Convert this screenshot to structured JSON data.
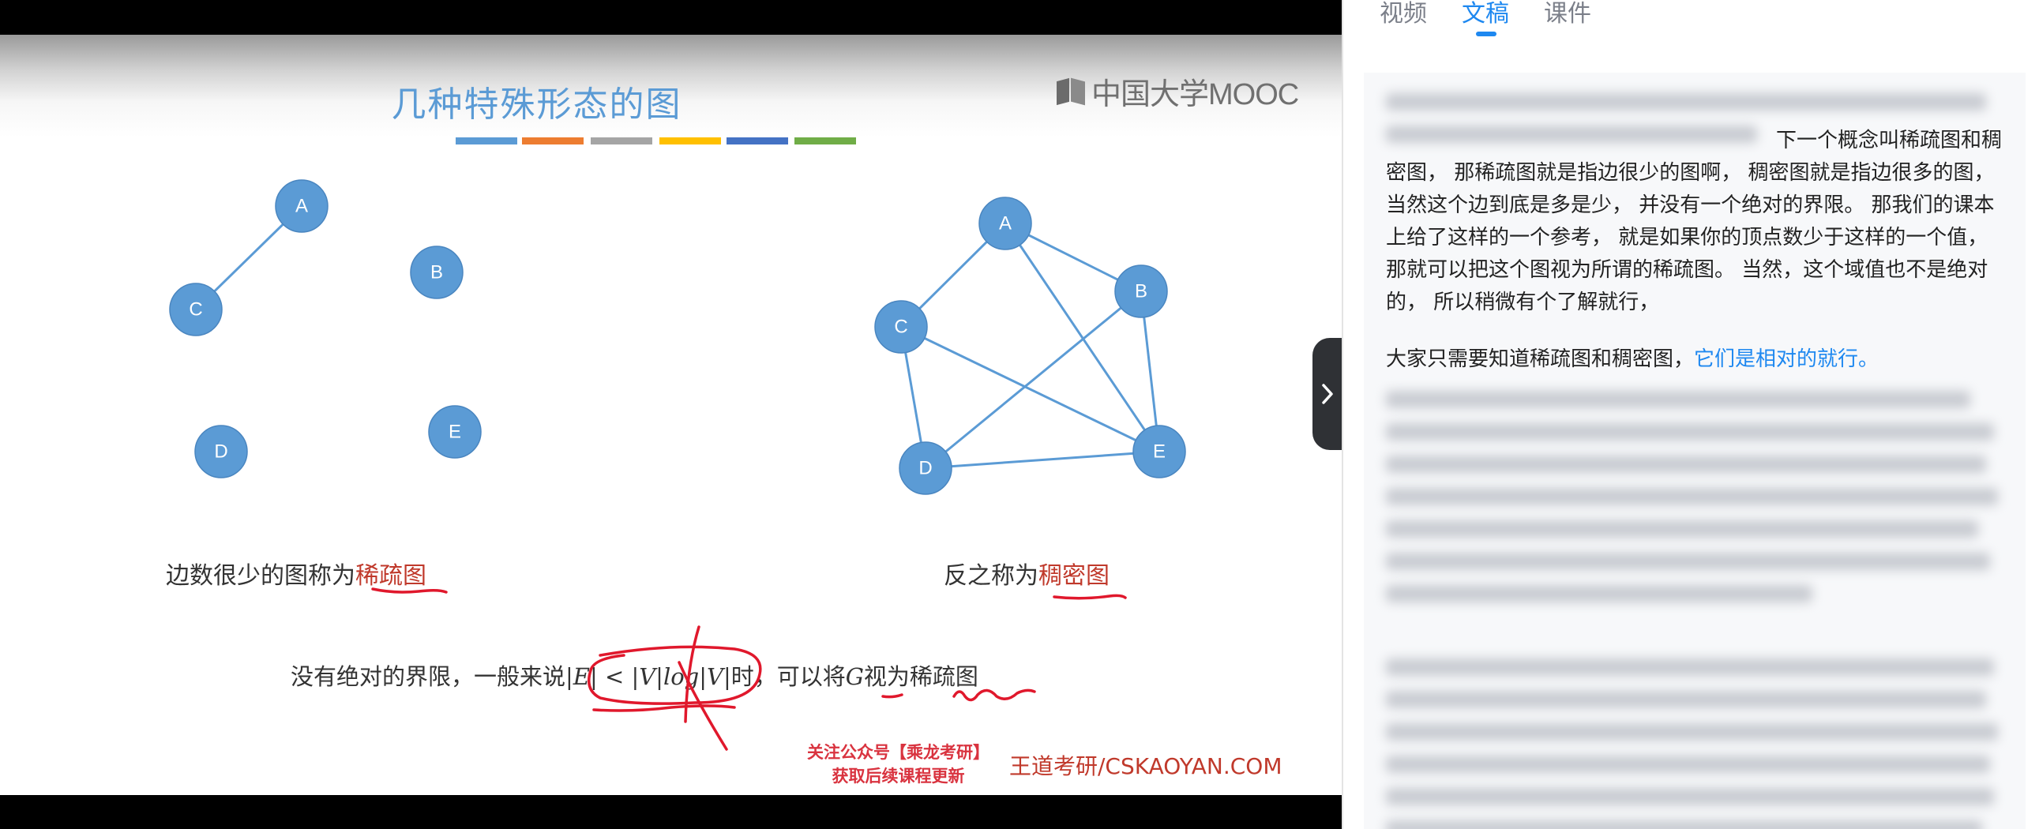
{
  "slide": {
    "title": "几种特殊形态的图",
    "logo_text": "中国大学MOOC",
    "color_bar_colors": [
      "#5b9bd5",
      "#ed7d31",
      "#a5a5a5",
      "#ffc000",
      "#4472c4",
      "#70ad47"
    ],
    "node_color": "#5b9bd5",
    "graph_left": {
      "nodes": [
        "A",
        "B",
        "C",
        "D",
        "E"
      ],
      "edges": [
        [
          "A",
          "C"
        ]
      ]
    },
    "graph_right": {
      "nodes": [
        "A",
        "B",
        "C",
        "D",
        "E"
      ],
      "edges": [
        [
          "A",
          "B"
        ],
        [
          "A",
          "C"
        ],
        [
          "A",
          "E"
        ],
        [
          "B",
          "D"
        ],
        [
          "B",
          "E"
        ],
        [
          "C",
          "D"
        ],
        [
          "C",
          "E"
        ],
        [
          "D",
          "E"
        ]
      ]
    },
    "caption_left_prefix": "边数很少的图称为",
    "caption_left_term": "稀疏图",
    "caption_right_prefix": "反之称为",
    "caption_right_term": "稠密图",
    "footnote_prefix": "没有绝对的界限，一般来说",
    "footnote_formula": "|E| < |V|log|V|",
    "footnote_middle": "时，可以将",
    "footnote_var": "G",
    "footnote_suffix": "视为稀疏图",
    "promo_line1": "关注公众号【乘龙考研】",
    "promo_line2": "获取后续课程更新",
    "website": "王道考研/CSKAOYAN.COM"
  },
  "panel": {
    "tabs": [
      {
        "label": "视频",
        "active": false
      },
      {
        "label": "文稿",
        "active": true
      },
      {
        "label": "课件",
        "active": false
      }
    ],
    "transcript_paragraph_1": "下一个概念叫稀疏图和稠密图， 那稀疏图就是指边很少的图啊， 稠密图就是指边很多的图， 当然这个边到底是多是少， 并没有一个绝对的界限。 那我们的课本上给了这样的一个参考， 就是如果你的顶点数少于这样的一个值， 那就可以把这个图视为所谓的稀疏图。 当然，这个域值也不是绝对的， 所以稍微有个了解就行，",
    "transcript_paragraph_2_plain": "大家只需要知道稀疏图和稠密图，",
    "transcript_paragraph_2_highlight": "它们是相对的就行。"
  }
}
